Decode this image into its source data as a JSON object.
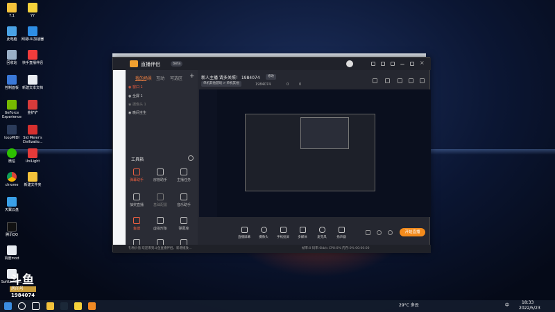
{
  "desktop": {
    "icons": [
      {
        "label": "7.1"
      },
      {
        "label": "YY"
      },
      {
        "label": "此电脑"
      },
      {
        "label": "网易UU加速器"
      },
      {
        "label": "回收站"
      },
      {
        "label": "快手直播伴侣"
      },
      {
        "label": "控制面板"
      },
      {
        "label": "新建文本文档"
      },
      {
        "label": "GeForce Experience"
      },
      {
        "label": "金铲铲"
      },
      {
        "label": "loopMIDI"
      },
      {
        "label": "Sid Meier's Civilizatio..."
      },
      {
        "label": "微信"
      },
      {
        "label": "UniLight"
      },
      {
        "label": "chrome"
      },
      {
        "label": "新建文件夹"
      },
      {
        "label": "天翼云盘"
      },
      {
        "label": "腾讯QQ"
      },
      {
        "label": "百度mod"
      },
      {
        "label": "SoftUninst..."
      }
    ]
  },
  "watermark": {
    "brand": "斗鱼",
    "room_label": "房间号",
    "room_number": "1984074"
  },
  "app": {
    "name": "直播伴侣",
    "version_badge": "beta",
    "tabs": [
      "我的场景",
      "互动",
      "可选区"
    ],
    "scenes": [
      {
        "name": "窗口 1",
        "selected": true
      },
      {
        "name": "全屏 1",
        "selected": false
      },
      {
        "name": "摄像头 1",
        "selected": false
      },
      {
        "name": "晚间主生",
        "selected": false
      }
    ],
    "tools_title": "工具箱",
    "tools": [
      {
        "label": "弹幕助手",
        "hot": true
      },
      {
        "label": "房管助手",
        "hot": false
      },
      {
        "label": "主播任务",
        "hot": false
      },
      {
        "label": "抽奖直播",
        "hot": false
      },
      {
        "label": "基础配置",
        "hot": false
      },
      {
        "label": "音乐助手",
        "hot": false
      },
      {
        "label": "鱼塘",
        "hot": true
      },
      {
        "label": "虚拟形象",
        "hot": false
      },
      {
        "label": "弹幕库",
        "hot": false
      },
      {
        "label": "",
        "hot": false
      },
      {
        "label": "",
        "hot": false
      },
      {
        "label": "",
        "hot": false
      }
    ],
    "stream_title": "新人主播 请多关照！ 1984074",
    "edit_chip": "修改",
    "category_chip": "单机其他游戏 > 单机其他",
    "meta": {
      "online": "1984074",
      "fans": "0",
      "gifts": "0"
    },
    "controls": [
      {
        "label": "直播屏幕"
      },
      {
        "label": "摄像头"
      },
      {
        "label": "手机投屏"
      },
      {
        "label": "多媒体"
      },
      {
        "label": "麦克风"
      },
      {
        "label": "扬声器"
      }
    ],
    "start_button": "开始直播",
    "status_left": "礼物价值  欢迎来到斗鱼直播伴侣，新增播放...",
    "status_right": "帧率:0  码率:0kb/s  CPU:0%  内存:0%  00:00:00"
  },
  "taskbar": {
    "weather": "29°C 多云",
    "time": "18:33",
    "date": "2022/5/23",
    "lang": "中"
  }
}
